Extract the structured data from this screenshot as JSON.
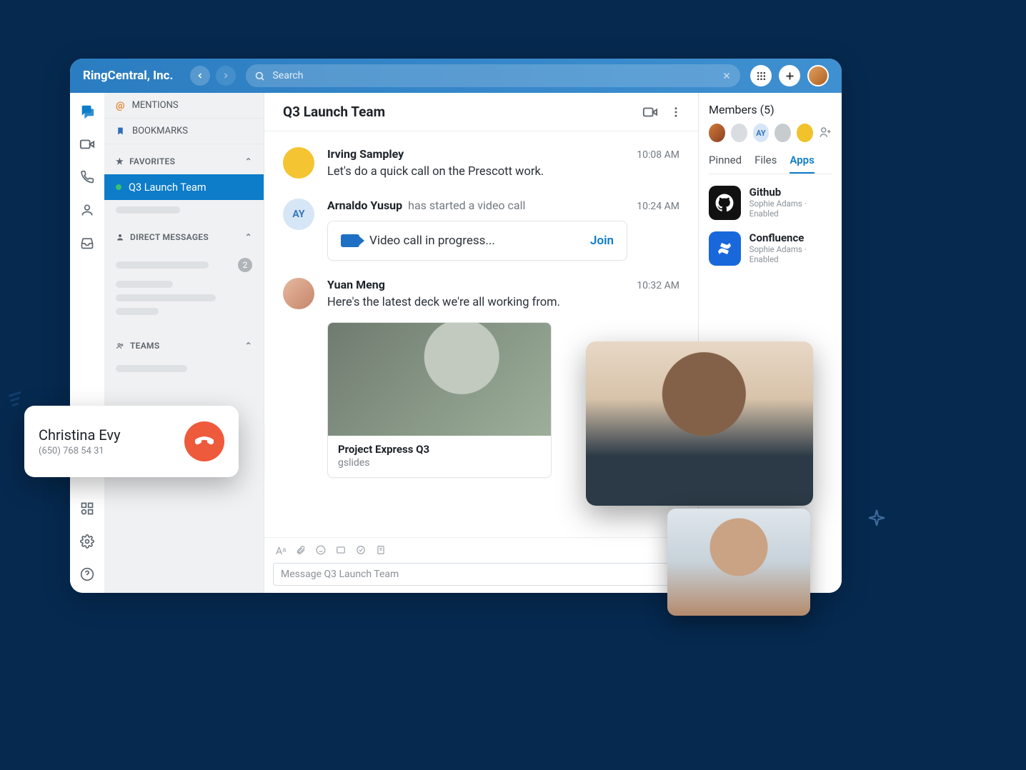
{
  "titlebar": {
    "brand": "RingCentral, Inc.",
    "search_placeholder": "Search"
  },
  "sidebar": {
    "mentions_label": "MENTIONS",
    "bookmarks_label": "BOOKMARKS",
    "favorites_label": "FAVORITES",
    "favorite_item": "Q3 Launch Team",
    "dm_label": "DIRECT MESSAGES",
    "dm_badge": "2",
    "teams_label": "TEAMS"
  },
  "chat": {
    "title": "Q3 Launch Team",
    "messages": [
      {
        "author": "Irving Sampley",
        "time": "10:08 AM",
        "text": "Let's do a quick call on the Prescott work."
      },
      {
        "author": "Arnaldo Yusup",
        "aux": "has started a video call",
        "time": "10:24 AM",
        "call_text": "Video call in progress...",
        "join": "Join",
        "initials": "AY"
      },
      {
        "author": "Yuan Meng",
        "time": "10:32 AM",
        "text": "Here's the latest deck we're all working from.",
        "attachment": {
          "title": "Project Express Q3",
          "sub": "gslides"
        }
      }
    ],
    "composer_placeholder": "Message Q3 Launch Team"
  },
  "right": {
    "members_label": "Members (5)",
    "member_initials": "AY",
    "tabs": {
      "pinned": "Pinned",
      "files": "Files",
      "apps": "Apps"
    },
    "apps": [
      {
        "name": "Github",
        "sub": "Sophie Adams · Enabled"
      },
      {
        "name": "Confluence",
        "sub": "Sophie Adams · Enabled"
      }
    ]
  },
  "incall": {
    "name": "Christina Evy",
    "number": "(650) 768 54 31"
  }
}
